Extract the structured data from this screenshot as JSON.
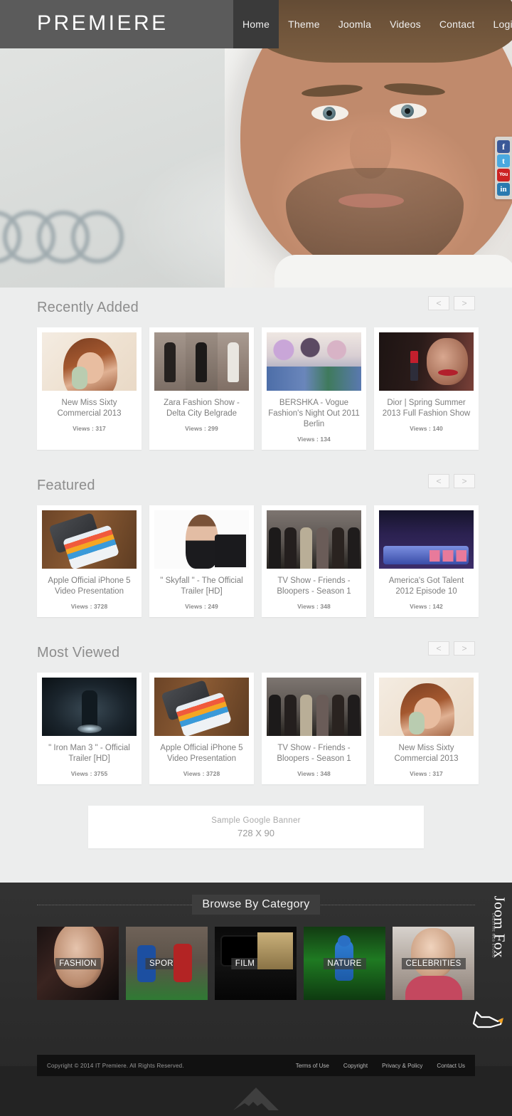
{
  "header": {
    "brand": "PREMIERE",
    "nav": [
      {
        "label": "Home",
        "active": true
      },
      {
        "label": "Theme",
        "active": false
      },
      {
        "label": "Joomla",
        "active": false
      },
      {
        "label": "Videos",
        "active": false
      },
      {
        "label": "Contact",
        "active": false
      },
      {
        "label": "Login",
        "active": false
      }
    ]
  },
  "social": [
    {
      "name": "facebook-icon",
      "glyph": "f",
      "color": "#3b5998"
    },
    {
      "name": "twitter-icon",
      "glyph": "t",
      "color": "#4aa9e0"
    },
    {
      "name": "youtube-icon",
      "glyph": "You",
      "color": "#cc2222"
    },
    {
      "name": "linkedin-icon",
      "glyph": "in",
      "color": "#2a7ab0"
    }
  ],
  "carousel_controls": {
    "prev": "<",
    "next": ">"
  },
  "sections": [
    {
      "title": "Recently Added",
      "items": [
        {
          "title": "New Miss Sixty Commercial 2013",
          "views": "Views : 317",
          "art": "th-misssixty"
        },
        {
          "title": "Zara Fashion Show - Delta City Belgrade",
          "views": "Views : 299",
          "art": "th-zara"
        },
        {
          "title": "BERSHKA - Vogue Fashion's Night Out 2011 Berlin",
          "views": "Views : 134",
          "art": "th-bershka"
        },
        {
          "title": "Dior | Spring Summer 2013 Full Fashion Show",
          "views": "Views : 140",
          "art": "th-dior"
        }
      ]
    },
    {
      "title": "Featured",
      "items": [
        {
          "title": "Apple Official iPhone 5 Video Presentation",
          "views": "Views : 3728",
          "art": "th-iphone"
        },
        {
          "title": "\" Skyfall \" - The Official Trailer [HD]",
          "views": "Views : 249",
          "art": "th-skyfall"
        },
        {
          "title": "TV Show - Friends - Bloopers - Season 1",
          "views": "Views : 348",
          "art": "th-friends"
        },
        {
          "title": "America's Got Talent 2012 Episode 10",
          "views": "Views : 142",
          "art": "th-agt"
        }
      ]
    },
    {
      "title": "Most Viewed",
      "items": [
        {
          "title": "\" Iron Man 3 \" - Official Trailer [HD]",
          "views": "Views : 3755",
          "art": "th-ironman"
        },
        {
          "title": "Apple Official iPhone 5 Video Presentation",
          "views": "Views : 3728",
          "art": "th-iphone"
        },
        {
          "title": "TV Show - Friends - Bloopers - Season 1",
          "views": "Views : 348",
          "art": "th-friends"
        },
        {
          "title": "New Miss Sixty Commercial 2013",
          "views": "Views : 317",
          "art": "th-misssixty"
        }
      ]
    }
  ],
  "banner": {
    "line1": "Sample Google Banner",
    "line2": "728 X 90"
  },
  "categories": {
    "title": "Browse By Category",
    "items": [
      {
        "label": "FASHION",
        "art": "cat-fashion"
      },
      {
        "label": "SPORTS",
        "art": "cat-sports"
      },
      {
        "label": "FILM & TV",
        "art": "cat-film"
      },
      {
        "label": "NATURE",
        "art": "cat-nature"
      },
      {
        "label": "CELEBRITIES",
        "art": "cat-celebs"
      }
    ]
  },
  "brand_mark": {
    "text": "Joom Fox",
    "tagline": "CREATIVE WEB STUDIO"
  },
  "footer": {
    "copyright": "Copyright © 2014 IT Premiere. All Rights Reserved.",
    "links": [
      "Terms of Use",
      "Copyright",
      "Privacy & Policy",
      "Contact Us"
    ]
  },
  "colors": {
    "header_bg": "#5b5b5b",
    "nav_active_bg": "#3a3a3a",
    "page_bg": "#eceded",
    "section_title": "#8d8d8d",
    "card_bg": "#ffffff",
    "category_bg": "#2f2f2f",
    "footer_bg": "#232323",
    "footer_bar_bg": "#111111"
  }
}
